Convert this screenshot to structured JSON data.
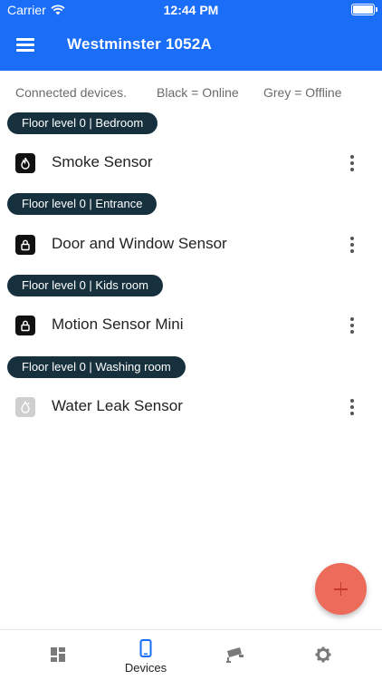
{
  "status_bar": {
    "carrier": "Carrier",
    "time": "12:44 PM"
  },
  "appbar": {
    "title": "Westminster 1052A"
  },
  "legend": {
    "connected": "Connected devices.",
    "online": "Black = Online",
    "offline": "Grey = Offline"
  },
  "groups": [
    {
      "location": "Floor level 0 | Bedroom",
      "device": {
        "name": "Smoke Sensor",
        "icon": "flame-icon",
        "status": "online"
      }
    },
    {
      "location": "Floor level 0 | Entrance",
      "device": {
        "name": "Door and Window Sensor",
        "icon": "lock-icon",
        "status": "online"
      }
    },
    {
      "location": "Floor level 0 | Kids room",
      "device": {
        "name": "Motion Sensor Mini",
        "icon": "lock-icon",
        "status": "online"
      }
    },
    {
      "location": "Floor level 0 | Washing room",
      "device": {
        "name": "Water Leak Sensor",
        "icon": "droplet-icon",
        "status": "offline"
      }
    }
  ],
  "fab": {
    "icon": "plus-icon"
  },
  "bottom_nav": {
    "items": [
      {
        "icon": "dashboard-icon",
        "label": ""
      },
      {
        "icon": "phone-icon",
        "label": "Devices",
        "active": true
      },
      {
        "icon": "cctv-camera-icon",
        "label": ""
      },
      {
        "icon": "gear-icon",
        "label": ""
      }
    ]
  },
  "colors": {
    "primary": "#1a6df7",
    "pill": "#17303d",
    "fab": "#ed6b5b",
    "active_tab": "#1a6df7",
    "inactive_tab": "#7a7a7a",
    "online_icon": "#111111",
    "offline_icon": "#cfcfcf"
  }
}
